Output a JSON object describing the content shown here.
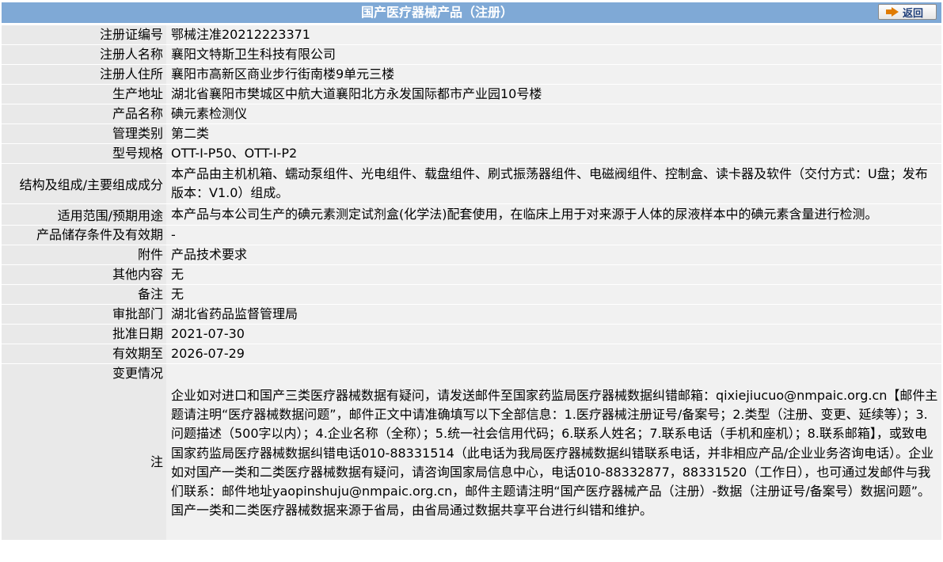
{
  "header": {
    "title": "国产医疗器械产品（注册）",
    "back_label": "返回"
  },
  "rows": [
    {
      "label": "注册证编号",
      "value": "鄂械注准20212223371"
    },
    {
      "label": "注册人名称",
      "value": "襄阳文特斯卫生科技有限公司"
    },
    {
      "label": "注册人住所",
      "value": "襄阳市高新区商业步行街南楼9单元三楼"
    },
    {
      "label": "生产地址",
      "value": "湖北省襄阳市樊城区中航大道襄阳北方永发国际都市产业园10号楼"
    },
    {
      "label": "产品名称",
      "value": "碘元素检测仪"
    },
    {
      "label": "管理类别",
      "value": "第二类"
    },
    {
      "label": "型号规格",
      "value": "OTT-I-P50、OTT-I-P2"
    },
    {
      "label": "结构及组成/主要组成成分",
      "value": "本产品由主机机箱、蠕动泵组件、光电组件、载盘组件、刷式振荡器组件、电磁阀组件、控制盒、读卡器及软件（交付方式：U盘；发布版本：V1.0）组成。"
    },
    {
      "label": "适用范围/预期用途",
      "value": "本产品与本公司生产的碘元素测定试剂盒(化学法)配套使用，在临床上用于对来源于人体的尿液样本中的碘元素含量进行检测。"
    },
    {
      "label": "产品储存条件及有效期",
      "value": "-"
    },
    {
      "label": "附件",
      "value": "产品技术要求"
    },
    {
      "label": "其他内容",
      "value": "无"
    },
    {
      "label": "备注",
      "value": "无"
    },
    {
      "label": "审批部门",
      "value": "湖北省药品监督管理局"
    },
    {
      "label": "批准日期",
      "value": "2021-07-30"
    },
    {
      "label": "有效期至",
      "value": "2026-07-29"
    },
    {
      "label": "变更情况",
      "value": ""
    }
  ],
  "note": {
    "label": "注",
    "text": "企业如对进口和国产三类医疗器械数据有疑问，请发送邮件至国家药监局医疗器械数据纠错邮箱：qixiejiucuo@nmpaic.org.cn【邮件主题请注明“医疗器械数据问题”，邮件正文中请准确填写以下全部信息：1.医疗器械注册证号/备案号；2.类型（注册、变更、延续等）；3.问题描述（500字以内）；4.企业名称（全称）；5.统一社会信用代码；6.联系人姓名；7.联系电话（手机和座机）；8.联系邮箱】，或致电国家药监局医疗器械数据纠错电话010-88331514（此电话为我局医疗器械数据纠错联系电话，并非相应产品/企业业务咨询电话）。企业如对国产一类和二类医疗器械数据有疑问，请咨询国家局信息中心，电话010-88332877，88331520（工作日），也可通过发邮件与我们联系：邮件地址yaopinshuju@nmpaic.org.cn，邮件主题请注明“国产医疗器械产品（注册）-数据（注册证号/备案号）数据问题”。国产一类和二类医疗器械数据来源于省局，由省局通过数据共享平台进行纠错和维护。"
  },
  "colors": {
    "header_bg": "#7fa9d6",
    "label_bg": "#e9e9e9",
    "value_bg": "#f1f1f1"
  }
}
